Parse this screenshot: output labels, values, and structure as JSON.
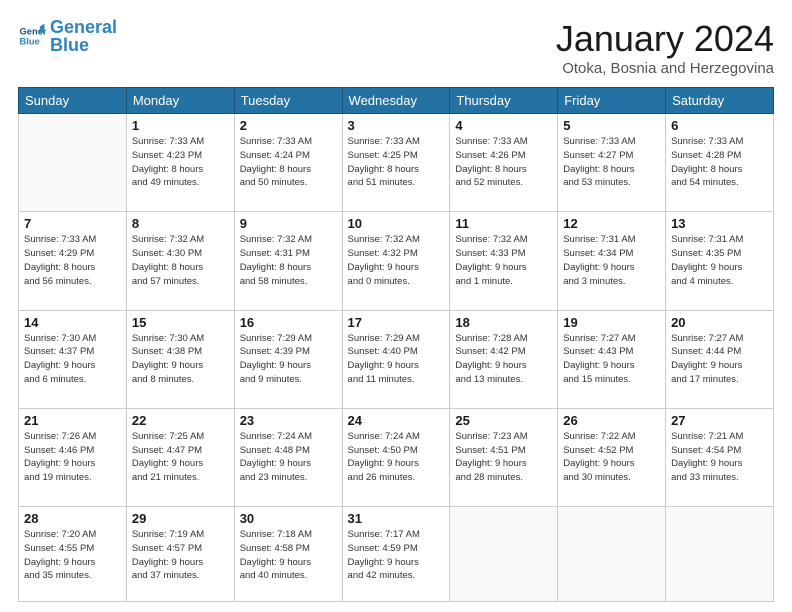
{
  "header": {
    "logo_text_general": "General",
    "logo_text_blue": "Blue",
    "month_title": "January 2024",
    "location": "Otoka, Bosnia and Herzegovina"
  },
  "days_of_week": [
    "Sunday",
    "Monday",
    "Tuesday",
    "Wednesday",
    "Thursday",
    "Friday",
    "Saturday"
  ],
  "weeks": [
    [
      {
        "day": "",
        "info": ""
      },
      {
        "day": "1",
        "info": "Sunrise: 7:33 AM\nSunset: 4:23 PM\nDaylight: 8 hours\nand 49 minutes."
      },
      {
        "day": "2",
        "info": "Sunrise: 7:33 AM\nSunset: 4:24 PM\nDaylight: 8 hours\nand 50 minutes."
      },
      {
        "day": "3",
        "info": "Sunrise: 7:33 AM\nSunset: 4:25 PM\nDaylight: 8 hours\nand 51 minutes."
      },
      {
        "day": "4",
        "info": "Sunrise: 7:33 AM\nSunset: 4:26 PM\nDaylight: 8 hours\nand 52 minutes."
      },
      {
        "day": "5",
        "info": "Sunrise: 7:33 AM\nSunset: 4:27 PM\nDaylight: 8 hours\nand 53 minutes."
      },
      {
        "day": "6",
        "info": "Sunrise: 7:33 AM\nSunset: 4:28 PM\nDaylight: 8 hours\nand 54 minutes."
      }
    ],
    [
      {
        "day": "7",
        "info": "Sunrise: 7:33 AM\nSunset: 4:29 PM\nDaylight: 8 hours\nand 56 minutes."
      },
      {
        "day": "8",
        "info": "Sunrise: 7:32 AM\nSunset: 4:30 PM\nDaylight: 8 hours\nand 57 minutes."
      },
      {
        "day": "9",
        "info": "Sunrise: 7:32 AM\nSunset: 4:31 PM\nDaylight: 8 hours\nand 58 minutes."
      },
      {
        "day": "10",
        "info": "Sunrise: 7:32 AM\nSunset: 4:32 PM\nDaylight: 9 hours\nand 0 minutes."
      },
      {
        "day": "11",
        "info": "Sunrise: 7:32 AM\nSunset: 4:33 PM\nDaylight: 9 hours\nand 1 minute."
      },
      {
        "day": "12",
        "info": "Sunrise: 7:31 AM\nSunset: 4:34 PM\nDaylight: 9 hours\nand 3 minutes."
      },
      {
        "day": "13",
        "info": "Sunrise: 7:31 AM\nSunset: 4:35 PM\nDaylight: 9 hours\nand 4 minutes."
      }
    ],
    [
      {
        "day": "14",
        "info": "Sunrise: 7:30 AM\nSunset: 4:37 PM\nDaylight: 9 hours\nand 6 minutes."
      },
      {
        "day": "15",
        "info": "Sunrise: 7:30 AM\nSunset: 4:38 PM\nDaylight: 9 hours\nand 8 minutes."
      },
      {
        "day": "16",
        "info": "Sunrise: 7:29 AM\nSunset: 4:39 PM\nDaylight: 9 hours\nand 9 minutes."
      },
      {
        "day": "17",
        "info": "Sunrise: 7:29 AM\nSunset: 4:40 PM\nDaylight: 9 hours\nand 11 minutes."
      },
      {
        "day": "18",
        "info": "Sunrise: 7:28 AM\nSunset: 4:42 PM\nDaylight: 9 hours\nand 13 minutes."
      },
      {
        "day": "19",
        "info": "Sunrise: 7:27 AM\nSunset: 4:43 PM\nDaylight: 9 hours\nand 15 minutes."
      },
      {
        "day": "20",
        "info": "Sunrise: 7:27 AM\nSunset: 4:44 PM\nDaylight: 9 hours\nand 17 minutes."
      }
    ],
    [
      {
        "day": "21",
        "info": "Sunrise: 7:26 AM\nSunset: 4:46 PM\nDaylight: 9 hours\nand 19 minutes."
      },
      {
        "day": "22",
        "info": "Sunrise: 7:25 AM\nSunset: 4:47 PM\nDaylight: 9 hours\nand 21 minutes."
      },
      {
        "day": "23",
        "info": "Sunrise: 7:24 AM\nSunset: 4:48 PM\nDaylight: 9 hours\nand 23 minutes."
      },
      {
        "day": "24",
        "info": "Sunrise: 7:24 AM\nSunset: 4:50 PM\nDaylight: 9 hours\nand 26 minutes."
      },
      {
        "day": "25",
        "info": "Sunrise: 7:23 AM\nSunset: 4:51 PM\nDaylight: 9 hours\nand 28 minutes."
      },
      {
        "day": "26",
        "info": "Sunrise: 7:22 AM\nSunset: 4:52 PM\nDaylight: 9 hours\nand 30 minutes."
      },
      {
        "day": "27",
        "info": "Sunrise: 7:21 AM\nSunset: 4:54 PM\nDaylight: 9 hours\nand 33 minutes."
      }
    ],
    [
      {
        "day": "28",
        "info": "Sunrise: 7:20 AM\nSunset: 4:55 PM\nDaylight: 9 hours\nand 35 minutes."
      },
      {
        "day": "29",
        "info": "Sunrise: 7:19 AM\nSunset: 4:57 PM\nDaylight: 9 hours\nand 37 minutes."
      },
      {
        "day": "30",
        "info": "Sunrise: 7:18 AM\nSunset: 4:58 PM\nDaylight: 9 hours\nand 40 minutes."
      },
      {
        "day": "31",
        "info": "Sunrise: 7:17 AM\nSunset: 4:59 PM\nDaylight: 9 hours\nand 42 minutes."
      },
      {
        "day": "",
        "info": ""
      },
      {
        "day": "",
        "info": ""
      },
      {
        "day": "",
        "info": ""
      }
    ]
  ]
}
